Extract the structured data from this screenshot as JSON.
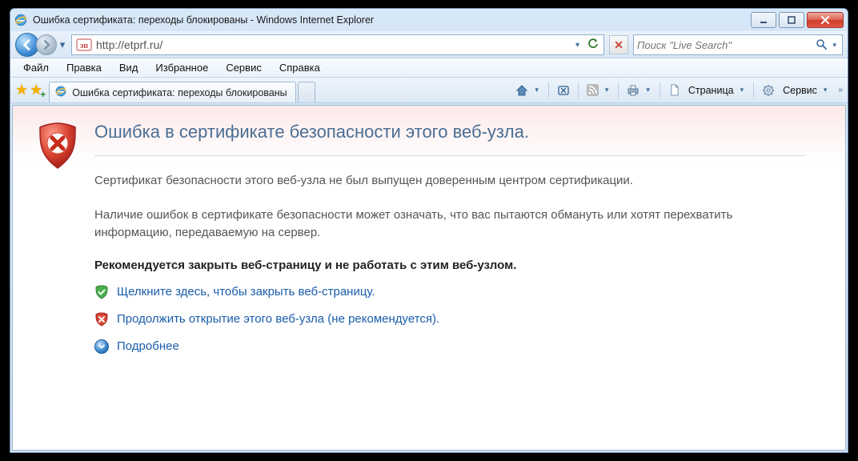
{
  "window": {
    "title": "Ошибка сертификата: переходы блокированы - Windows Internet Explorer"
  },
  "address_bar": {
    "url": "http://etprf.ru/"
  },
  "search": {
    "placeholder": "Поиск \"Live Search\""
  },
  "menu": {
    "items": [
      "Файл",
      "Правка",
      "Вид",
      "Избранное",
      "Сервис",
      "Справка"
    ]
  },
  "tab": {
    "title": "Ошибка сертификата: переходы блокированы"
  },
  "cmdbar": {
    "page_label": "Страница",
    "service_label": "Сервис"
  },
  "cert": {
    "heading": "Ошибка в сертификате безопасности этого веб-узла.",
    "line1": "Сертификат безопасности этого веб-узла не был выпущен доверенным центром сертификации.",
    "line2": "Наличие ошибок в сертификате безопасности может означать, что вас пытаются обмануть или хотят перехватить информацию, передаваемую на сервер.",
    "recommend": "Рекомендуется закрыть веб-страницу и не работать с этим веб-узлом.",
    "close_link": "Щелкните здесь, чтобы закрыть веб-страницу.",
    "continue_link": "Продолжить открытие этого веб-узла (не рекомендуется).",
    "more_link": "Подробнее"
  }
}
